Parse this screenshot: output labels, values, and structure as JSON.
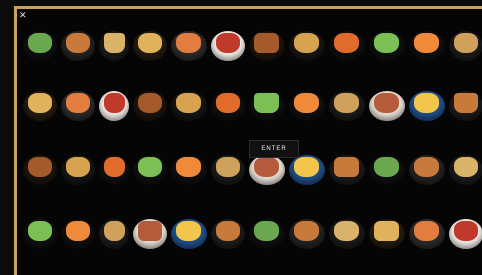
{
  "screen": {
    "button_label": "ENTER",
    "frame_color": "#c8a45a",
    "background": "#050505",
    "close_icon": "close-icon"
  },
  "rows": [
    {
      "dishes": [
        "avocado-toast",
        "waffle",
        "dessert-glass",
        "tacos",
        "pasta-bowl",
        "salad-plate",
        "burger-stack",
        "sushi-rolls",
        "shrimp",
        "salad-bowl",
        "shrimp",
        "tacos",
        "toast"
      ]
    },
    {
      "dishes": [
        "toast",
        "seafood-bowl",
        "sandwich",
        "tart",
        "sandwich",
        "salad-bowl",
        "shots",
        "deviled-eggs",
        "wrap",
        "seafood-bowl",
        "seafood-bowl",
        "drink",
        "shots",
        "sushi-rolls"
      ]
    },
    {
      "dishes": [
        "cake",
        "apples",
        "soup-bowl",
        "pizza",
        "pizza",
        "soup-bowl",
        "salad-bowl",
        "pizza",
        "burger",
        "noodles-bowl",
        "pizza",
        "soup-bowl",
        "pizza"
      ]
    },
    {
      "dishes": [
        "salad",
        "sushi",
        "hotdog",
        "burger",
        "sushi",
        "salad-bowl",
        "hotdog",
        "sushi",
        "dumpling",
        "burger",
        "steak-plate",
        "soup-bowl",
        "sushi"
      ]
    }
  ]
}
